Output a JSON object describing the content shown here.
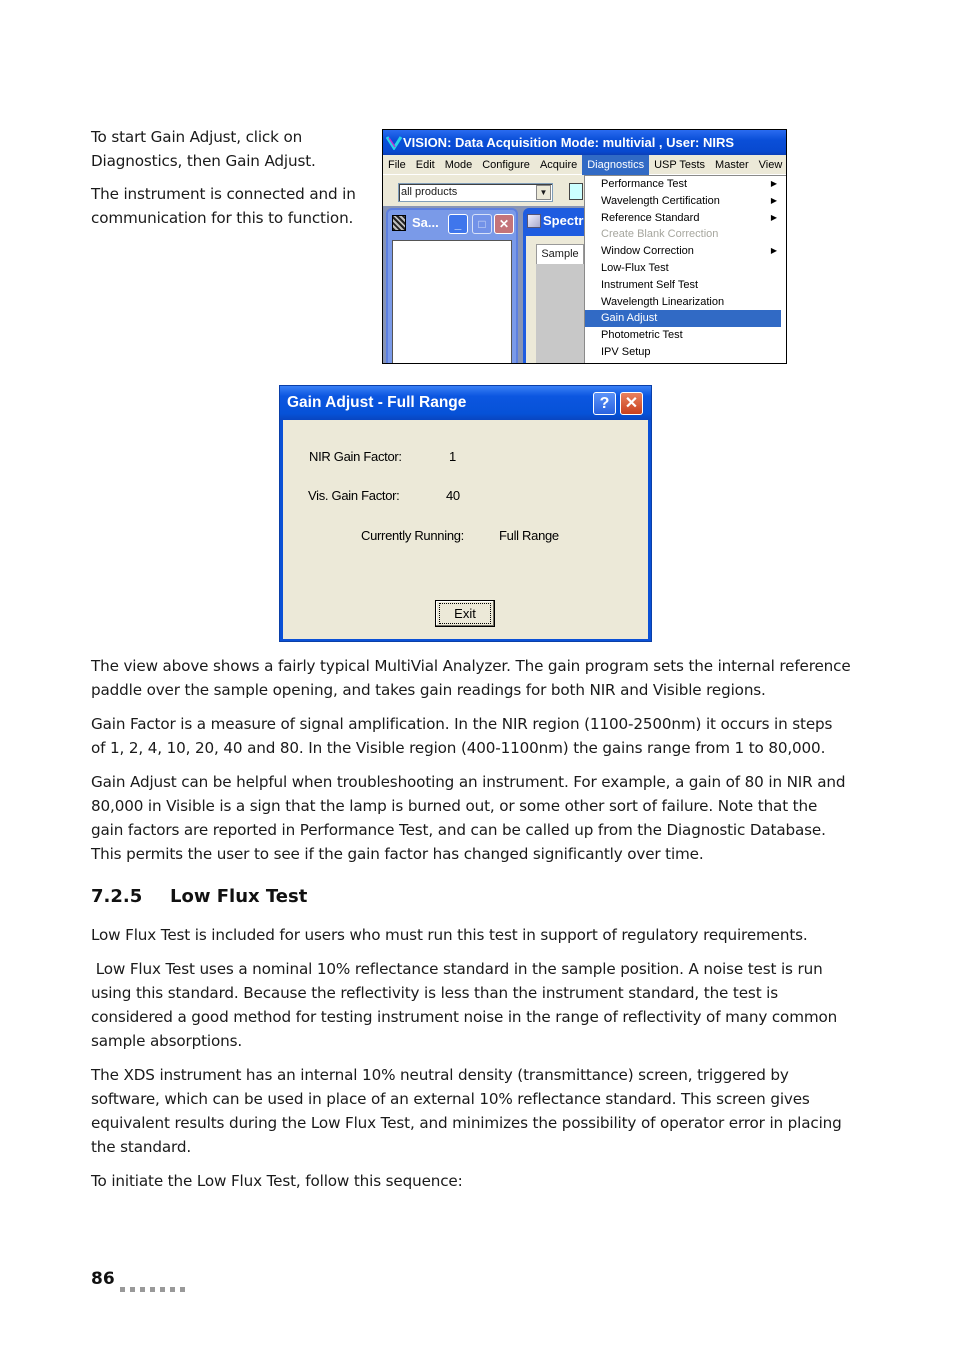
{
  "intro": {
    "para1": "To start Gain Adjust, click on Diagnostics, then Gain Adjust.",
    "para2": "The instrument is connected and in communication for this to function."
  },
  "vision_window": {
    "title": "VISION: Data Acquisition Mode: multivial , User: NIRS",
    "menu": [
      "File",
      "Edit",
      "Mode",
      "Configure",
      "Acquire",
      "Diagnostics",
      "USP Tests",
      "Master",
      "View"
    ],
    "active_menu": "Diagnostics",
    "product_combo": "all products",
    "child_window_1_title": "Sa...",
    "child_window_2_title": "Spectr",
    "tab_label": "Sample",
    "diagnostics_menu": [
      {
        "label": "Performance Test",
        "submenu": true,
        "state": "normal"
      },
      {
        "label": "Wavelength Certification",
        "submenu": true,
        "state": "normal"
      },
      {
        "label": "Reference Standard",
        "submenu": true,
        "state": "normal"
      },
      {
        "label": "Create Blank Correction",
        "submenu": false,
        "state": "disabled"
      },
      {
        "label": "Window Correction",
        "submenu": true,
        "state": "normal"
      },
      {
        "label": "Low-Flux Test",
        "submenu": false,
        "state": "normal"
      },
      {
        "label": "Instrument Self Test",
        "submenu": false,
        "state": "normal"
      },
      {
        "label": "Wavelength Linearization",
        "submenu": false,
        "state": "normal"
      },
      {
        "label": "Gain Adjust",
        "submenu": false,
        "state": "selected"
      },
      {
        "label": "Photometric Test",
        "submenu": false,
        "state": "normal"
      },
      {
        "label": "IPV Setup",
        "submenu": false,
        "state": "normal"
      }
    ]
  },
  "gain_dialog": {
    "title": "Gain Adjust - Full Range",
    "help_label": "?",
    "close_label": "✕",
    "nir_label": "NIR Gain Factor:",
    "nir_value": "1",
    "vis_label": "Vis. Gain Factor:",
    "vis_value": "40",
    "running_label": "Currently Running:",
    "running_value": "Full Range",
    "exit_label": "Exit"
  },
  "body": {
    "p1": "The view above shows a fairly typical MultiVial Analyzer. The gain program sets the internal reference paddle over the sample opening, and takes gain readings for both NIR and Visible regions.",
    "p2": "Gain Factor is a measure of signal amplification. In the NIR region (1100-2500nm) it occurs in steps of 1, 2, 4, 10, 20, 40 and 80. In the Visible region (400-1100nm) the gains range from 1 to 80,000.",
    "p3": "Gain Adjust can be helpful when troubleshooting an instrument. For example, a gain of 80 in NIR and 80,000 in Visible is a sign that the lamp is burned out, or some other sort of failure. Note that the gain factors are reported in Performance Test, and can be called up from the Diagnostic Database. This permits the user to see if the gain factor has changed significantly over time."
  },
  "section": {
    "number": "7.2.5",
    "title": "Low Flux Test",
    "p1": "Low Flux Test is included for users who must run this test in support of regulatory requirements.",
    "p2": " Low Flux Test uses a nominal 10% reflectance standard in the sample position. A noise test is run using this standard. Because the reflectivity is less than the instrument standard, the test is considered a good method for testing instrument noise in the range of reflectivity of many common sample absorptions.",
    "p3": "The XDS instrument has an internal 10% neutral density (transmittance) screen, triggered by software, which can be used in place of an external 10% reflectance standard. This screen gives equivalent results during the Low Flux Test, and minimizes the possibility of operator error in placing the standard.",
    "p4": "To initiate the Low Flux Test, follow this sequence:"
  },
  "footer": {
    "page_number": "86"
  }
}
